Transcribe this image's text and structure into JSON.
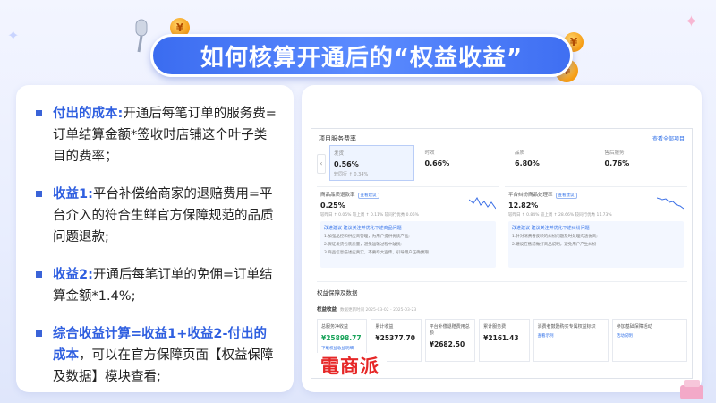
{
  "banner": {
    "title": "如何核算开通后的“权益收益”"
  },
  "left": {
    "items": [
      {
        "head": "付出的成本:",
        "body": "开通后每笔订单的服务费=订单结算金额*签收时店铺这个叶子类目的费率；"
      },
      {
        "head": "收益1:",
        "body": "平台补偿给商家的退赔费用=平台介入的符合生鲜官方保障规范的品质问题退款;"
      },
      {
        "head": "收益2:",
        "body": "开通后每笔订单的免佣=订单结算金额*1.4%;"
      },
      {
        "head": "综合收益计算=收益1+收益2-付出的成本",
        "body": "，可以在官方保障页面【权益保障及数据】模块查看;"
      }
    ]
  },
  "screenshot": {
    "section_title": "项目服务费率",
    "link": "查看全部项目",
    "metrics": [
      {
        "label": "发货",
        "value": "0.56%",
        "sub": "较同行 ↑ 0.34%"
      },
      {
        "label": "时效",
        "value": "0.66%",
        "sub": ""
      },
      {
        "label": "品质",
        "value": "6.80%",
        "sub": ""
      },
      {
        "label": "售后服务",
        "value": "0.76%",
        "sub": ""
      }
    ],
    "mid": [
      {
        "label": "商品品质退款率",
        "tag": "查看建议",
        "value": "0.25%",
        "sub": "较昨日 ↑ 0.05%   较上周 ↑ 0.11%   较同行优秀 0.06%",
        "tip_title": "改进建议 建议关注并优化下述商品问题",
        "tip_lines": [
          "1.加强品控和供应商管理，为用户提供优质产品;",
          "2.保证发货包装质量，避免运输过程中破损;",
          "3.商品信息描述应真实，不要夸大宣传，引导用户正确预期"
        ]
      },
      {
        "label": "平台纠纷商品处理率",
        "tag": "查看建议",
        "value": "12.82%",
        "sub": "较昨日 ↑ 0.84%   较上周 ↑ 28.66%   较同行优秀 11.73%",
        "tip_title": "改进建议 建议关注并优化下述纠纷问题",
        "tip_lines": [
          "1.针对消费者反映的纠纷问题及时处理沟通协商;",
          "2.建议在售前做好商品说明，避免用户产生纠纷"
        ]
      }
    ],
    "section2_title": "权益保障及数据",
    "section2_sub": "权益收益",
    "section2_note": "数据更新时间 2025-03-02 - 2025-03-23",
    "cards": [
      {
        "label": "总服务净收益",
        "value": "¥25898.77",
        "foot": "下载权益收益明细",
        "green": true
      },
      {
        "label": "累计收益",
        "value": "¥25377.70",
        "foot": "",
        "green": false
      },
      {
        "label": "平台补偿退赔费用总额",
        "value": "¥2682.50",
        "foot": "",
        "green": false
      },
      {
        "label": "累计服务费",
        "value": "¥2161.43",
        "foot": "",
        "green": false
      },
      {
        "label": "消费者鼓励购买专属权益标识",
        "value": "",
        "foot": "查看示例",
        "green": false
      },
      {
        "label": "参加基础保障活动",
        "value": "",
        "foot": "活动说明",
        "green": false
      }
    ]
  },
  "stamp": "電商派"
}
